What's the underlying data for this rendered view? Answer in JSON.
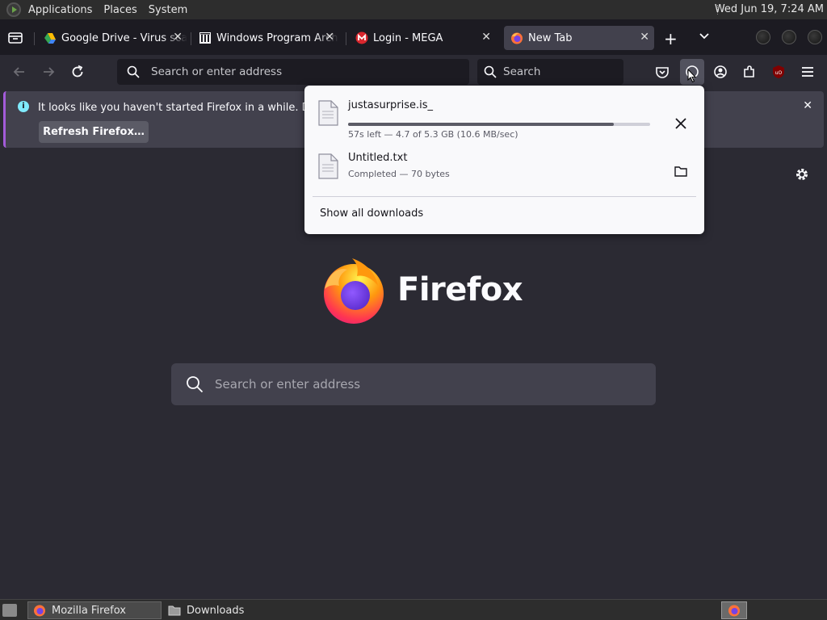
{
  "top_panel": {
    "menus": [
      "Applications",
      "Places",
      "System"
    ],
    "clock": "Wed Jun 19,  7:24 AM"
  },
  "tabs": [
    {
      "title": "Google Drive - Virus scan warning",
      "active": false
    },
    {
      "title": "Windows Program Archive",
      "active": false
    },
    {
      "title": "Login - MEGA",
      "active": false
    },
    {
      "title": "New Tab",
      "active": true
    }
  ],
  "nav": {
    "url_placeholder": "Search or enter address",
    "search_placeholder": "Search"
  },
  "notification": {
    "text": "It looks like you haven't started Firefox in a while. Do you",
    "button": "Refresh Firefox…"
  },
  "downloads": {
    "items": [
      {
        "name": "justasurprise.is_",
        "status": "57s left — 4.7 of 5.3 GB (10.6 MB/sec)",
        "progress": 0.88
      },
      {
        "name": "Untitled.txt",
        "status": "Completed — 70 bytes"
      }
    ],
    "show_all": "Show all downloads"
  },
  "newtab": {
    "brand": "Firefox",
    "search_placeholder": "Search or enter address"
  },
  "taskbar": {
    "tasks": [
      "Mozilla Firefox",
      "Downloads"
    ]
  },
  "colors": {
    "accent": "#a35bd9",
    "background": "#2b2a33",
    "info": "#80ebff"
  }
}
